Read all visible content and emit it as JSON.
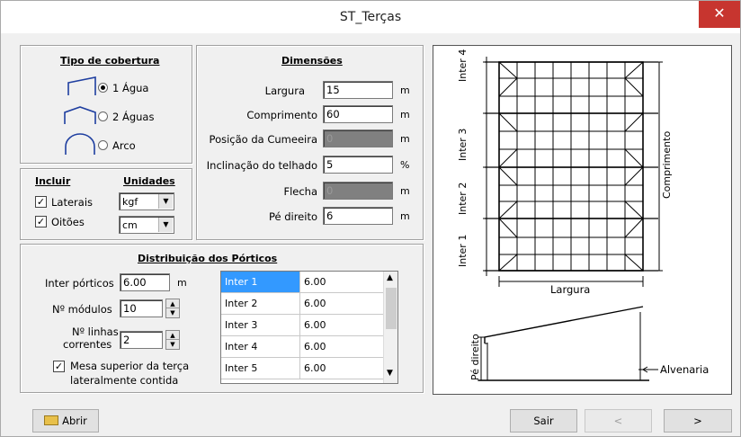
{
  "window": {
    "title": "ST_Terças",
    "close_glyph": "✕"
  },
  "tipo_cobertura": {
    "heading": "Tipo de cobertura",
    "options": [
      {
        "label": "1 Água",
        "checked": true,
        "icon": "one-slope-roof-icon"
      },
      {
        "label": "2 Águas",
        "checked": false,
        "icon": "two-slope-roof-icon"
      },
      {
        "label": "Arco",
        "checked": false,
        "icon": "arch-roof-icon"
      }
    ]
  },
  "incluir": {
    "heading": "Incluir",
    "items": [
      {
        "label": "Laterais",
        "checked": true
      },
      {
        "label": "Oitões",
        "checked": true
      }
    ]
  },
  "unidades": {
    "heading": "Unidades",
    "force_unit": "kgf",
    "length_unit": "cm"
  },
  "dimensoes": {
    "heading": "Dimensões",
    "fields": [
      {
        "label": "Largura",
        "value": "15",
        "unit": "m",
        "disabled": false
      },
      {
        "label": "Comprimento",
        "value": "60",
        "unit": "m",
        "disabled": false
      },
      {
        "label": "Posição da Cumeeira",
        "value": "0",
        "unit": "m",
        "disabled": true
      },
      {
        "label": "Inclinação do telhado",
        "value": "5",
        "unit": "%",
        "disabled": false
      },
      {
        "label": "Flecha",
        "value": "0",
        "unit": "m",
        "disabled": true
      },
      {
        "label": "Pé direito",
        "value": "6",
        "unit": "m",
        "disabled": false
      }
    ]
  },
  "porticos": {
    "heading": "Distribuição dos Pórticos",
    "inter_porticos_label": "Inter pórticos",
    "inter_porticos_value": "6.00",
    "inter_porticos_unit": "m",
    "modulos_label": "Nº módulos",
    "modulos_value": "10",
    "linhas_label_1": "Nº linhas",
    "linhas_label_2": "correntes",
    "linhas_value": "2",
    "mesa_label_1": "Mesa superior da terça",
    "mesa_label_2": "lateralmente contida",
    "mesa_checked": true,
    "table": [
      {
        "name": "Inter 1",
        "value": "6.00"
      },
      {
        "name": "Inter 2",
        "value": "6.00"
      },
      {
        "name": "Inter 3",
        "value": "6.00"
      },
      {
        "name": "Inter 4",
        "value": "6.00"
      },
      {
        "name": "Inter 5",
        "value": "6.00"
      }
    ]
  },
  "drawing": {
    "inter_labels": [
      "Inter 4",
      "Inter 3",
      "Inter 2",
      "Inter 1"
    ],
    "comprimento": "Comprimento",
    "largura": "Largura",
    "pe_direito": "Pé direito",
    "alvenaria": "Alvenaria"
  },
  "buttons": {
    "abrir": "Abrir",
    "sair": "Sair",
    "prev": "<",
    "next": ">"
  }
}
